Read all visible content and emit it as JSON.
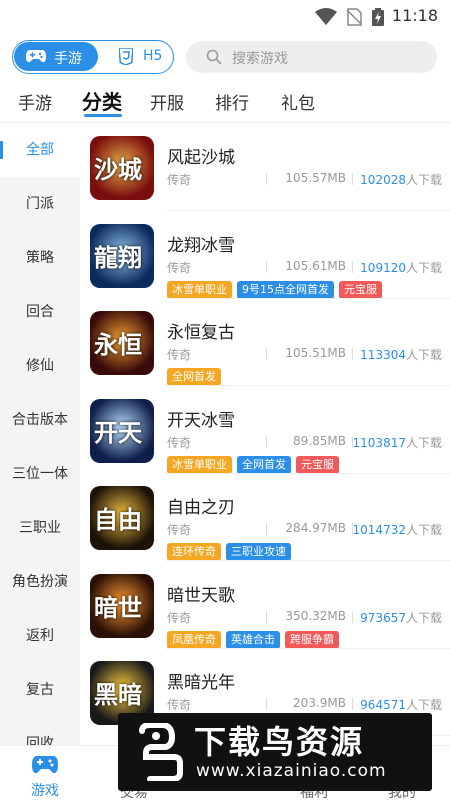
{
  "status_bar": {
    "time": "11:18"
  },
  "header": {
    "segment": {
      "active": "手游",
      "inactive": "H5"
    },
    "search": {
      "placeholder": "搜索游戏"
    }
  },
  "tabs": [
    {
      "label": "手游"
    },
    {
      "label": "分类"
    },
    {
      "label": "开服"
    },
    {
      "label": "排行"
    },
    {
      "label": "礼包"
    }
  ],
  "active_tab": "分类",
  "sidebar": {
    "items": [
      {
        "label": "全部"
      },
      {
        "label": "门派"
      },
      {
        "label": "策略"
      },
      {
        "label": "回合"
      },
      {
        "label": "修仙"
      },
      {
        "label": "合击版本"
      },
      {
        "label": "三位一体"
      },
      {
        "label": "三职业"
      },
      {
        "label": "角色扮演"
      },
      {
        "label": "返利"
      },
      {
        "label": "复古"
      },
      {
        "label": "回收"
      }
    ],
    "active": "全部"
  },
  "games": [
    {
      "name": "风起沙城",
      "genre": "传奇",
      "size": "105.57MB",
      "downloads": "102028",
      "downloads_suffix": "人下载",
      "thumb_text": "沙城",
      "tags": []
    },
    {
      "name": "龙翔冰雪",
      "genre": "传奇",
      "size": "105.61MB",
      "downloads": "109120",
      "downloads_suffix": "人下载",
      "thumb_text": "龍翔",
      "tags": [
        {
          "label": "冰雪单职业",
          "color": "#f5a623"
        },
        {
          "label": "9号15点全网首发",
          "color": "#2b8fe8"
        },
        {
          "label": "元宝服",
          "color": "#f25a5a"
        }
      ]
    },
    {
      "name": "永恒复古",
      "genre": "传奇",
      "size": "105.51MB",
      "downloads": "113304",
      "downloads_suffix": "人下载",
      "thumb_text": "永恒",
      "tags": [
        {
          "label": "全网首发",
          "color": "#f5a623"
        }
      ]
    },
    {
      "name": "开天冰雪",
      "genre": "传奇",
      "size": "89.85MB",
      "downloads": "1103817",
      "downloads_suffix": "人下载",
      "thumb_text": "开天",
      "tags": [
        {
          "label": "冰雪单职业",
          "color": "#f5a623"
        },
        {
          "label": "全网首发",
          "color": "#2b8fe8"
        },
        {
          "label": "元宝服",
          "color": "#f25a5a"
        }
      ]
    },
    {
      "name": "自由之刃",
      "genre": "传奇",
      "size": "284.97MB",
      "downloads": "1014732",
      "downloads_suffix": "人下载",
      "thumb_text": "自由",
      "tags": [
        {
          "label": "连环传奇",
          "color": "#f5a623"
        },
        {
          "label": "三职业攻速",
          "color": "#2b8fe8"
        }
      ]
    },
    {
      "name": "暗世天歌",
      "genre": "传奇",
      "size": "350.32MB",
      "downloads": "973657",
      "downloads_suffix": "人下载",
      "thumb_text": "暗世",
      "tags": [
        {
          "label": "凤凰传奇",
          "color": "#f5a623"
        },
        {
          "label": "英雄合击",
          "color": "#2b8fe8"
        },
        {
          "label": "跨服争霸",
          "color": "#f25a5a"
        }
      ]
    },
    {
      "name": "黑暗光年",
      "genre": "传奇",
      "size": "203.9MB",
      "downloads": "964571",
      "downloads_suffix": "人下载",
      "thumb_text": "黑暗",
      "tags": [
        {
          "label": "",
          "color": "#f5a623"
        },
        {
          "label": "",
          "color": "#2b8fe8"
        }
      ]
    }
  ],
  "bottom_nav": [
    {
      "label": "游戏",
      "icon": "gamepad-icon"
    },
    {
      "label": "交易",
      "icon": "trade-icon"
    },
    {
      "label": "福利",
      "icon": "gift-icon"
    },
    {
      "label": "我的",
      "icon": "user-icon"
    }
  ],
  "watermark": {
    "title": "下载鸟资源",
    "url": "www.xiazainiao.com"
  },
  "colors": {
    "accent": "#2b8fe8",
    "orange": "#f5a623",
    "red": "#f25a5a"
  }
}
